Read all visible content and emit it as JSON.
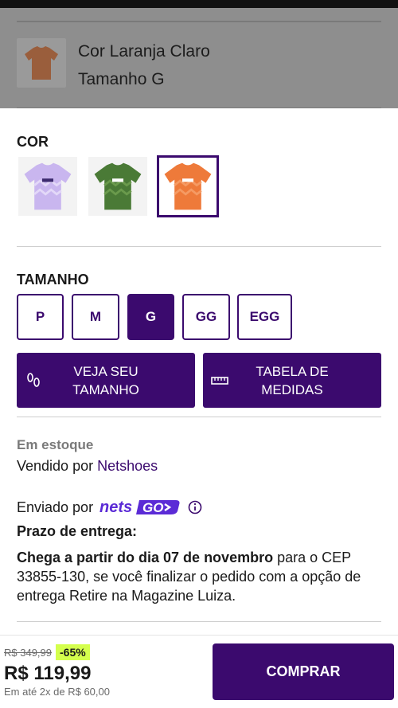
{
  "selection_summary": {
    "color_line": "Cor Laranja Claro",
    "size_line": "Tamanho G"
  },
  "color_section": {
    "label": "COR",
    "swatches": [
      {
        "name": "lilac-jersey",
        "color": "#c9b6ef",
        "selected": false
      },
      {
        "name": "green-jersey",
        "color": "#4a7a36",
        "selected": false
      },
      {
        "name": "orange-jersey",
        "color": "#ee7a3a",
        "selected": true
      }
    ]
  },
  "size_section": {
    "label": "TAMANHO",
    "sizes": [
      "P",
      "M",
      "G",
      "GG",
      "EGG"
    ],
    "selected": "G"
  },
  "actions": {
    "see_size_line1": "VEJA SEU",
    "see_size_line2": "TAMANHO",
    "measures_line1": "TABELA DE",
    "measures_line2": "MEDIDAS"
  },
  "availability": {
    "stock": "Em estoque",
    "sold_by_prefix": "Vendido por ",
    "seller": "Netshoes",
    "shipped_by": "Enviado por",
    "shipper_logo_text": "netsGO"
  },
  "delivery": {
    "title": "Prazo de entrega:",
    "bold_part": "Chega a partir do dia 07 de novembro",
    "rest": " para o CEP 33855-130, se você finalizar o pedido com a opção de entrega Retire na Magazine Luiza."
  },
  "price": {
    "old": "R$ 349,99",
    "discount": "-65%",
    "current": "R$ 119,99",
    "installments": "Em até 2x de R$ 60,00"
  },
  "buy_label": "COMPRAR",
  "colors": {
    "brand_purple": "#3b0a6e",
    "discount_badge": "#d4ff4d"
  }
}
